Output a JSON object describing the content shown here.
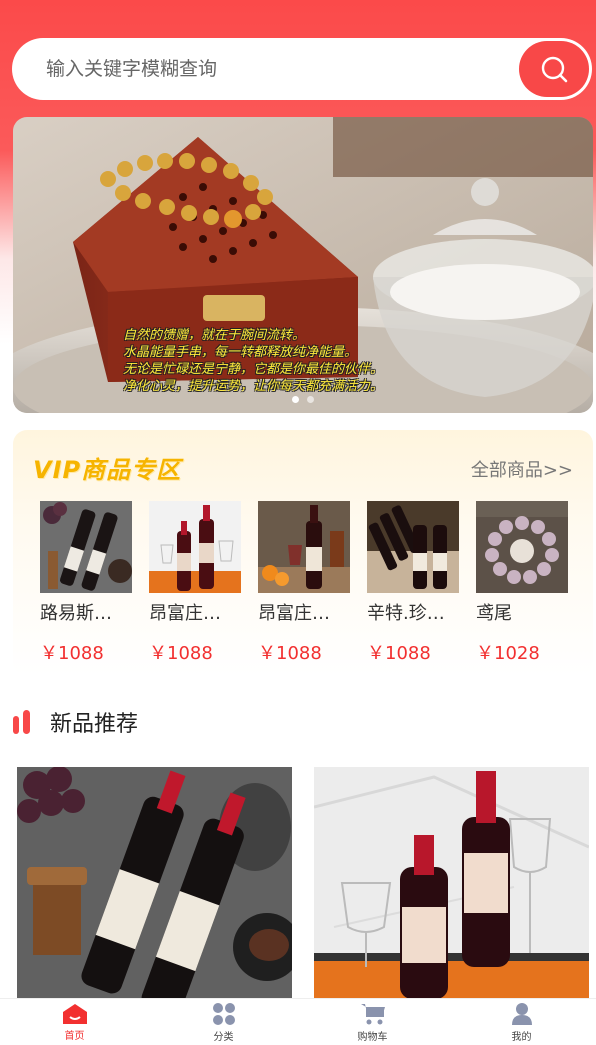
{
  "search": {
    "placeholder": "输入关键字模糊查询",
    "button_icon": "search-icon"
  },
  "banner": {
    "caption_lines": [
      "自然的馈赠，就在于腕间流转。",
      "水晶能量手串，每一转都释放纯净能量。",
      "无论是忙碌还是宁静，它都是你最佳的伙伴。",
      "净化心灵，提升运势，让你每天都充满活力。"
    ],
    "slide_count": 2,
    "active_slide": 1
  },
  "vip": {
    "title": "VIP商品专区",
    "all_link": "全部商品>>",
    "items": [
      {
        "name": "路易斯…",
        "price": "￥1088"
      },
      {
        "name": "昂富庄…",
        "price": "￥1088"
      },
      {
        "name": "昂富庄…",
        "price": "￥1088"
      },
      {
        "name": "辛特.珍…",
        "price": "￥1088"
      },
      {
        "name": "鸢尾",
        "price": "￥1028"
      }
    ]
  },
  "new_products": {
    "title": "新品推荐"
  },
  "tabbar": {
    "items": [
      {
        "label": "首页",
        "icon": "home-icon",
        "active": true
      },
      {
        "label": "分类",
        "icon": "category-icon",
        "active": false
      },
      {
        "label": "购物车",
        "icon": "cart-icon",
        "active": false
      },
      {
        "label": "我的",
        "icon": "user-icon",
        "active": false
      }
    ]
  },
  "colors": {
    "accent": "#f84848",
    "price": "#f23030",
    "vip_gold": "#f6b400"
  }
}
